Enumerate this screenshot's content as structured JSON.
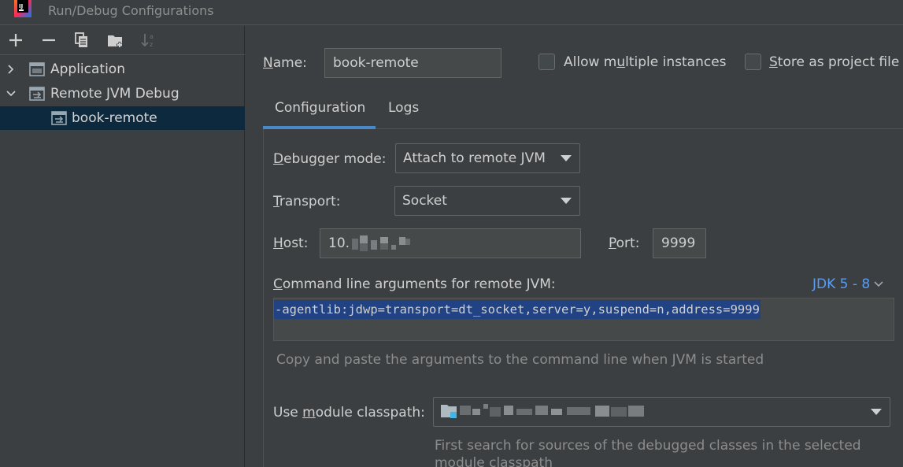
{
  "window": {
    "title": "Run/Debug Configurations"
  },
  "toolbar": {
    "add": "add-icon",
    "remove": "remove-icon",
    "copy": "copy-icon",
    "folder": "new-folder-icon",
    "sort": "sort-icon"
  },
  "tree": {
    "items": [
      {
        "label": "Application",
        "expanded": false
      },
      {
        "label": "Remote JVM Debug",
        "expanded": true
      },
      {
        "label": "book-remote",
        "selected": true
      }
    ]
  },
  "form": {
    "name_label": "Name:",
    "name_value": "book-remote",
    "allow_multiple_label": "Allow multiple instances",
    "allow_multiple_checked": false,
    "store_label": "Store as project file",
    "store_checked": false
  },
  "tabs": [
    {
      "label": "Configuration",
      "active": true
    },
    {
      "label": "Logs",
      "active": false
    }
  ],
  "config": {
    "debugger_mode_label": "Debugger mode:",
    "debugger_mode_value": "Attach to remote JVM",
    "transport_label": "Transport:",
    "transport_value": "Socket",
    "host_label": "Host:",
    "host_value": "10.",
    "port_label": "Port:",
    "port_value": "9999",
    "cmd_label": "Command line arguments for remote JVM:",
    "jdk_link": "JDK 5 - 8",
    "cmd_value": "-agentlib:jdwp=transport=dt_socket,server=y,suspend=n,address=9999",
    "cmd_hint": "Copy and paste the arguments to the command line when JVM is started",
    "module_label": "Use module classpath:",
    "module_hint": "First search for sources of the debugged classes in the selected module classpath"
  },
  "colors": {
    "background": "#3c3f41",
    "selection": "#0d293e",
    "accent": "#4a88c7",
    "link": "#589df6",
    "text_selection": "#214283"
  }
}
